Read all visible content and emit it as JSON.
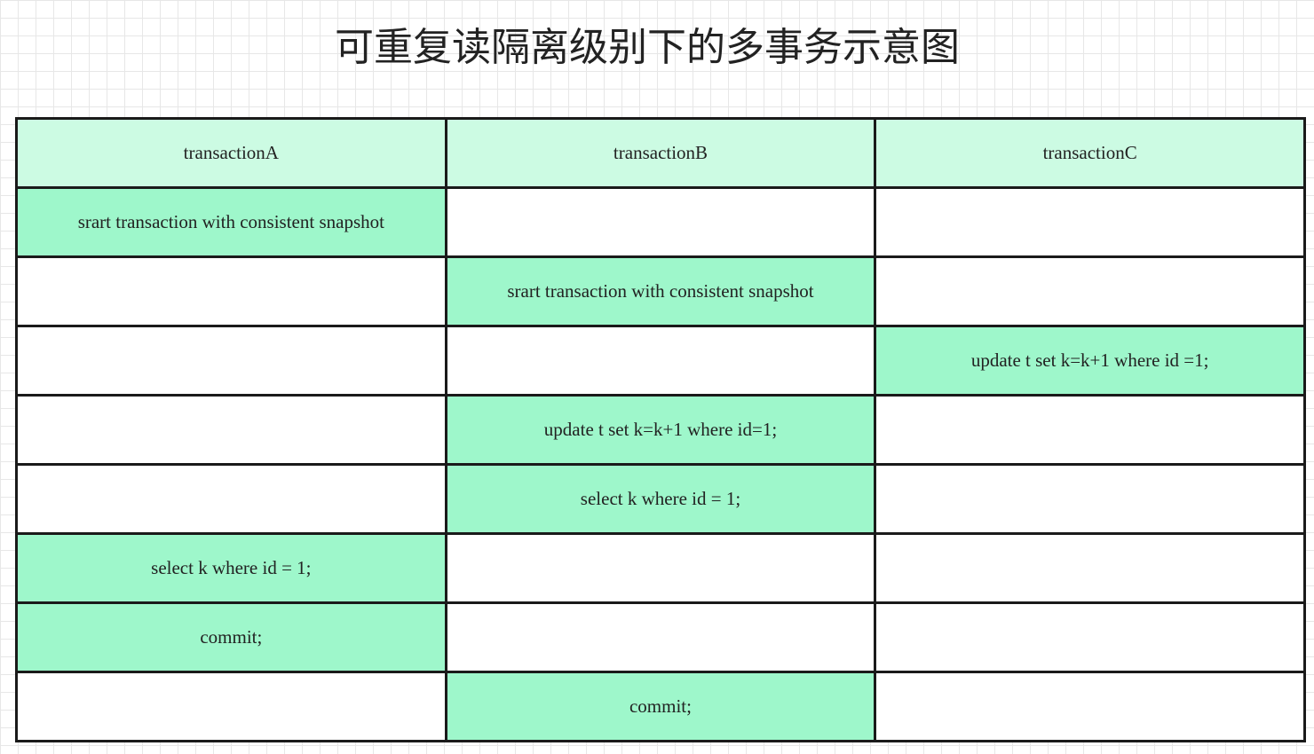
{
  "title": "可重复读隔离级别下的多事务示意图",
  "colors": {
    "header_fill": "#ccfbe3",
    "statement_fill": "#9ef7cb",
    "empty_fill": "#ffffff",
    "border": "#1a1a1a"
  },
  "headers": [
    "transactionA",
    "transactionB",
    "transactionC"
  ],
  "rows": [
    [
      "srart transaction with consistent snapshot",
      "",
      ""
    ],
    [
      "",
      "srart transaction with consistent snapshot",
      ""
    ],
    [
      "",
      "",
      "update t set k=k+1 where id =1;"
    ],
    [
      "",
      "update t set k=k+1 where id=1;",
      ""
    ],
    [
      "",
      "select k where id = 1;",
      ""
    ],
    [
      "select k where id = 1;",
      "",
      ""
    ],
    [
      "commit;",
      "",
      ""
    ],
    [
      "",
      "commit;",
      ""
    ]
  ]
}
